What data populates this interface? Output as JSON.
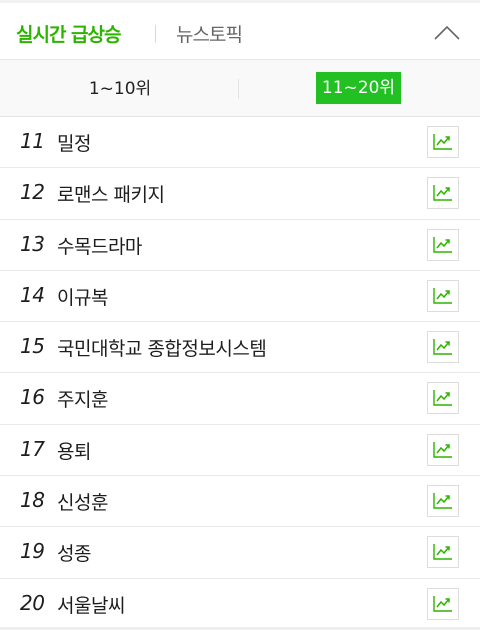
{
  "header": {
    "tab_realtime": "실시간 급상승",
    "tab_news": "뉴스토픽",
    "collapse_icon": "chevron-up-icon"
  },
  "range_tabs": {
    "first": "1~10위",
    "second": "11~20위",
    "selected": "second"
  },
  "colors": {
    "accent": "#2db400",
    "selected_bg": "#22c022",
    "trend_icon": "#2db400"
  },
  "keywords": [
    {
      "rank": "11",
      "keyword": "밀정"
    },
    {
      "rank": "12",
      "keyword": "로맨스 패키지"
    },
    {
      "rank": "13",
      "keyword": "수목드라마"
    },
    {
      "rank": "14",
      "keyword": "이규복"
    },
    {
      "rank": "15",
      "keyword": "국민대학교 종합정보시스템"
    },
    {
      "rank": "16",
      "keyword": "주지훈"
    },
    {
      "rank": "17",
      "keyword": "용퇴"
    },
    {
      "rank": "18",
      "keyword": "신성훈"
    },
    {
      "rank": "19",
      "keyword": "성종"
    },
    {
      "rank": "20",
      "keyword": "서울날씨"
    }
  ],
  "trend_icon_name": "trend-chart-icon"
}
